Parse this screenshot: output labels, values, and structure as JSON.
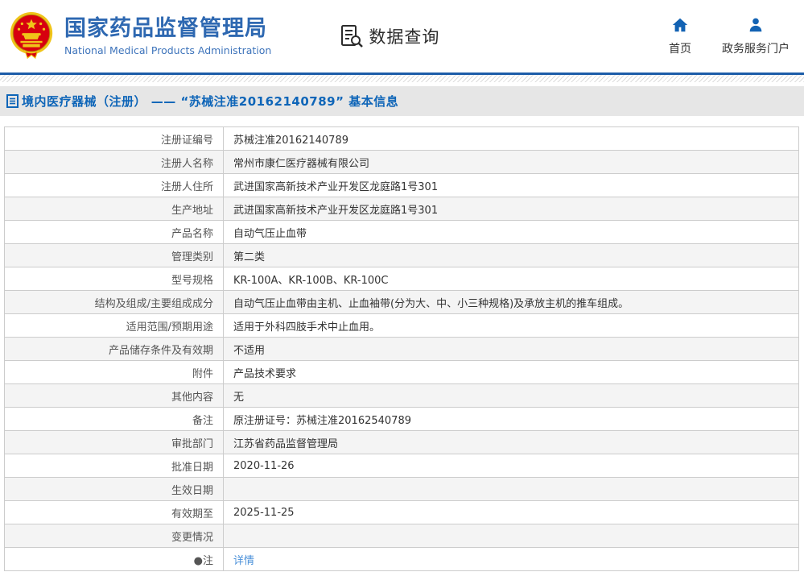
{
  "header": {
    "logo": {
      "title_cn": "国家药品监督管理局",
      "title_en": "National Medical Products Administration"
    },
    "data_query_label": "数据查询",
    "nav": [
      {
        "label": "首页",
        "icon": "home-icon"
      },
      {
        "label": "政务服务门户",
        "icon": "user-icon"
      }
    ]
  },
  "breadcrumb": {
    "text": "境内医疗器械（注册） —— “苏械注准20162140789” 基本信息"
  },
  "table": {
    "rows": [
      {
        "label": "注册证编号",
        "value": "苏械注准20162140789"
      },
      {
        "label": "注册人名称",
        "value": "常州市康仁医疗器械有限公司"
      },
      {
        "label": "注册人住所",
        "value": "武进国家高新技术产业开发区龙庭路1号301"
      },
      {
        "label": "生产地址",
        "value": "武进国家高新技术产业开发区龙庭路1号301"
      },
      {
        "label": "产品名称",
        "value": "自动气压止血带"
      },
      {
        "label": "管理类别",
        "value": "第二类"
      },
      {
        "label": "型号规格",
        "value": "KR-100A、KR-100B、KR-100C"
      },
      {
        "label": "结构及组成/主要组成成分",
        "value": "自动气压止血带由主机、止血袖带(分为大、中、小三种规格)及承放主机的推车组成。"
      },
      {
        "label": "适用范围/预期用途",
        "value": "适用于外科四肢手术中止血用。"
      },
      {
        "label": "产品储存条件及有效期",
        "value": "不适用"
      },
      {
        "label": "附件",
        "value": "产品技术要求"
      },
      {
        "label": "其他内容",
        "value": "无"
      },
      {
        "label": "备注",
        "value": "原注册证号：苏械注准20162540789"
      },
      {
        "label": "审批部门",
        "value": "江苏省药品监督管理局"
      },
      {
        "label": "批准日期",
        "value": "2020-11-26"
      },
      {
        "label": "生效日期",
        "value": ""
      },
      {
        "label": "有效期至",
        "value": "2025-11-25"
      },
      {
        "label": "变更情况",
        "value": ""
      },
      {
        "label": "●注",
        "value": "详情"
      }
    ]
  },
  "colors": {
    "accent_blue": "#1c5ca8",
    "title_blue": "#2e68b1",
    "crumb_blue": "#0e65b8",
    "link_blue": "#4a90d9",
    "emblem_red": "#d7000f",
    "emblem_gold": "#f0c419"
  }
}
